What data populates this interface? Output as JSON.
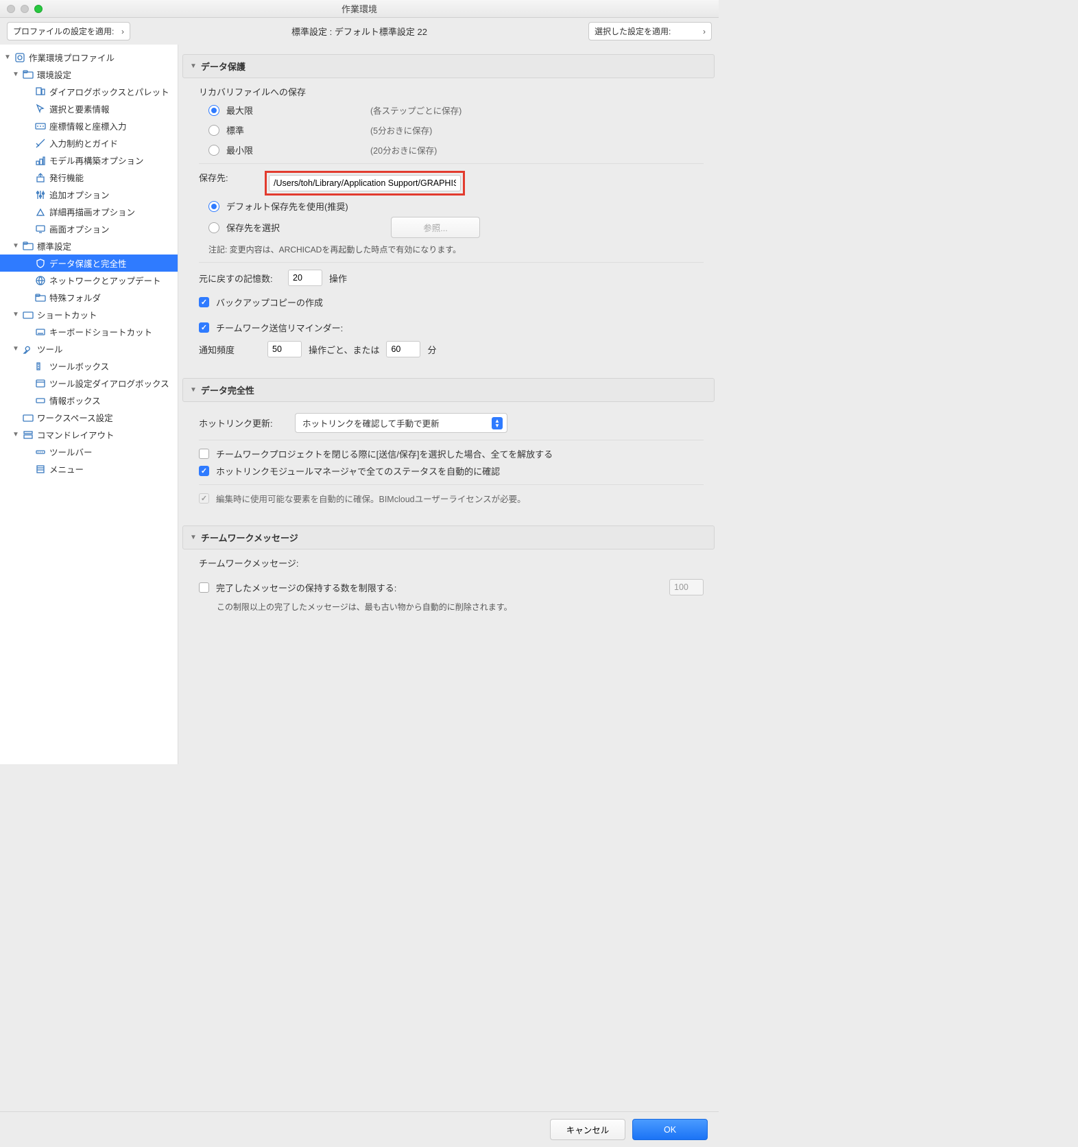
{
  "window": {
    "title": "作業環境"
  },
  "top": {
    "apply_profile": "プロファイルの設定を適用:",
    "center": "標準設定 :  デフォルト標準設定 22",
    "apply_selected": "選択した設定を適用:"
  },
  "tree": {
    "root": "作業環境プロファイル",
    "env": "環境設定",
    "env_items": {
      "dialogs": "ダイアログボックスとパレット",
      "selection": "選択と要素情報",
      "coords": "座標情報と座標入力",
      "input": "入力制約とガイド",
      "model": "モデル再構築オプション",
      "issue": "発行機能",
      "extra": "追加オプション",
      "redraw": "詳細再描画オプション",
      "screen": "画面オプション"
    },
    "std": "標準設定",
    "std_items": {
      "data": "データ保護と完全性",
      "network": "ネットワークとアップデート",
      "special": "特殊フォルダ"
    },
    "shortcuts": "ショートカット",
    "keyboard": "キーボードショートカット",
    "tools": "ツール",
    "tool_items": {
      "toolbox": "ツールボックス",
      "toolset": "ツール設定ダイアログボックス",
      "infobox": "情報ボックス"
    },
    "workspace": "ワークスペース設定",
    "cmdlayout": "コマンドレイアウト",
    "cmd_items": {
      "toolbar": "ツールバー",
      "menu": "メニュー"
    }
  },
  "s1": {
    "title": "データ保護",
    "recovery_label": "リカバリファイルへの保存",
    "opt_max": "最大限",
    "opt_max_hint": "(各ステップごとに保存)",
    "opt_std": "標準",
    "opt_std_hint": "(5分おきに保存)",
    "opt_min": "最小限",
    "opt_min_hint": "(20分おきに保存)",
    "save_loc_label": "保存先:",
    "save_path": "/Users/toh/Library/Application Support/GRAPHISOFT",
    "use_default": "デフォルト保存先を使用(推奨)",
    "choose_loc": "保存先を選択",
    "browse": "参照...",
    "restart_note": "注記: 変更内容は、ARCHICADを再起動した時点で有効になります。",
    "undo_label": "元に戻すの記憶数:",
    "undo_value": "20",
    "undo_unit": "操作",
    "backup": "バックアップコピーの作成",
    "team_reminder": "チームワーク送信リマインダー:",
    "notify_label": "通知頻度",
    "notify_ops": "50",
    "notify_ops_unit": "操作ごと、または",
    "notify_min": "60",
    "notify_min_unit": "分"
  },
  "s2": {
    "title": "データ完全性",
    "hotlink_label": "ホットリンク更新:",
    "hotlink_value": "ホットリンクを確認して手動で更新",
    "release_on_close": "チームワークプロジェクトを閉じる際に[送信/保存]を選択した場合、全てを解放する",
    "auto_status": "ホットリンクモジュールマネージャで全てのステータスを自動的に確認",
    "reserve_disabled": "編集時に使用可能な要素を自動的に確保。BIMcloudユーザーライセンスが必要。"
  },
  "s3": {
    "title": "チームワークメッセージ",
    "heading": "チームワークメッセージ:",
    "limit_label": "完了したメッセージの保持する数を制限する:",
    "limit_value": "100",
    "limit_note": "この制限以上の完了したメッセージは、最も古い物から自動的に削除されます。"
  },
  "footer": {
    "cancel": "キャンセル",
    "ok": "OK"
  }
}
